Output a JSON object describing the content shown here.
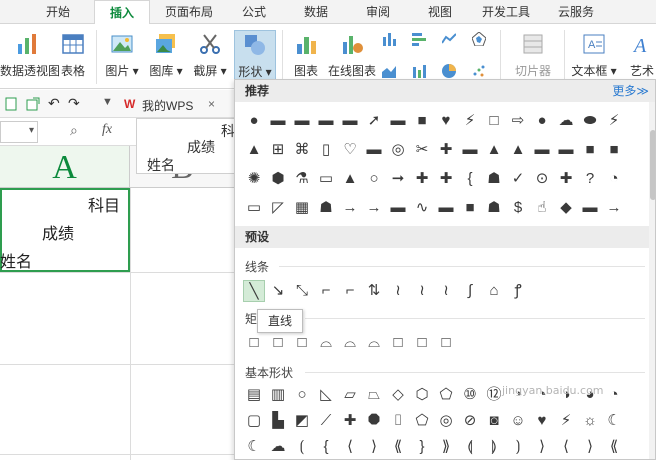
{
  "tabs": [
    "开始",
    "插入",
    "页面布局",
    "公式",
    "数据",
    "审阅",
    "视图",
    "开发工具",
    "云服务"
  ],
  "active_tab": "插入",
  "ribbon": {
    "pivot": "数据透视图",
    "table": "表格",
    "picture": "图片",
    "gallery": "图库",
    "screenshot": "截屏",
    "shape": "形状",
    "chart": "图表",
    "online_chart": "在线图表",
    "slicer": "切片器",
    "textbox": "文本框",
    "wordart": "艺术"
  },
  "doc_tab": {
    "label": "我的WPS",
    "close": "×"
  },
  "formula_bar": {
    "fx": "fx",
    "dropdown": "▾"
  },
  "sheet": {
    "col_a": "A",
    "col_b": "B",
    "cell_a1": {
      "line1": "科目",
      "line2": "成绩",
      "line3": "姓名"
    },
    "float_cell": {
      "line1": "科",
      "line2": "成绩",
      "line3": "姓名"
    }
  },
  "panel": {
    "recommend": "推荐",
    "more": "更多≫",
    "preset": "预设",
    "lines": "线条",
    "rect": "矩",
    "basic": "基本形状",
    "tooltip": "直线"
  },
  "watermark": "jingyan.baidu.com"
}
